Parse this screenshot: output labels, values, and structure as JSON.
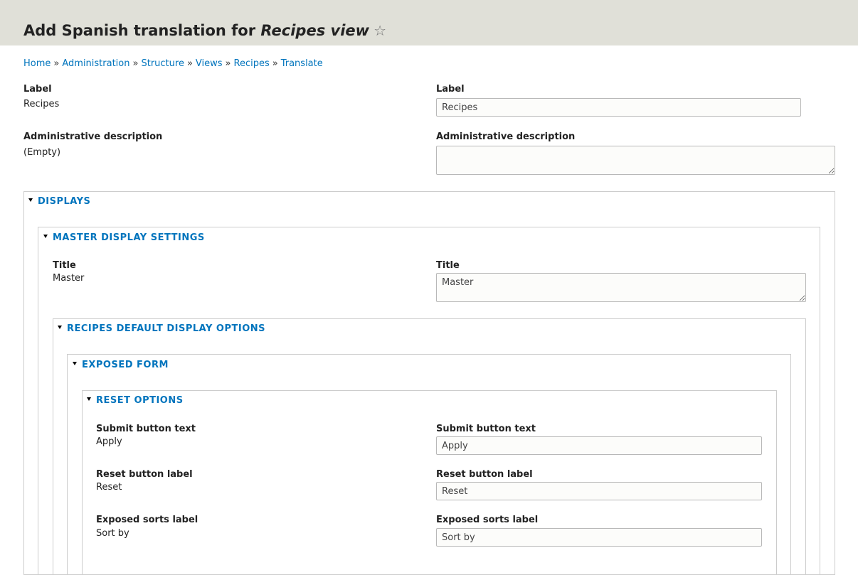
{
  "page": {
    "title_prefix": "Add Spanish translation for",
    "title_subject": "Recipes view"
  },
  "breadcrumb": {
    "sep": "»",
    "items": [
      "Home",
      "Administration",
      "Structure",
      "Views",
      "Recipes",
      "Translate"
    ]
  },
  "fields": {
    "label": {
      "label": "Label",
      "source": "Recipes",
      "value": "Recipes"
    },
    "description": {
      "label": "Administrative description",
      "source": "(Empty)",
      "value": ""
    }
  },
  "displays": {
    "legend": "DISPLAYS",
    "master": {
      "legend": "MASTER DISPLAY SETTINGS",
      "title": {
        "label": "Title",
        "source": "Master",
        "value": "Master"
      },
      "default_options": {
        "legend": "RECIPES DEFAULT DISPLAY OPTIONS",
        "exposed_form": {
          "legend": "EXPOSED FORM",
          "reset_options": {
            "legend": "RESET OPTIONS",
            "submit": {
              "label": "Submit button text",
              "source": "Apply",
              "value": "Apply"
            },
            "reset": {
              "label": "Reset button label",
              "source": "Reset",
              "value": "Reset"
            },
            "sorts": {
              "label": "Exposed sorts label",
              "source": "Sort by",
              "value": "Sort by"
            }
          }
        }
      }
    }
  },
  "colors": {
    "link": "#0074bd",
    "header_bg": "#e0e0d8",
    "border": "#cccccc"
  },
  "icons": {
    "favorite": "star-outline-icon",
    "collapse": "triangle-down-icon"
  }
}
